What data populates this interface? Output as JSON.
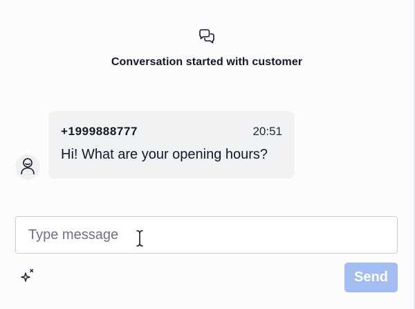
{
  "header": {
    "icon": "chat-bubbles-icon",
    "title": "Conversation started with customer"
  },
  "message": {
    "avatar_icon": "user-icon",
    "sender": "+1999888777",
    "time": "20:51",
    "text": "Hi! What are your opening hours?"
  },
  "composer": {
    "placeholder": "Type message",
    "value": "",
    "ai_icon": "sparkles-icon",
    "send_label": "Send",
    "send_color": "#a3bdf0"
  },
  "colors": {
    "bubble": "#f1f2f4",
    "background": "#fcfcfd"
  }
}
